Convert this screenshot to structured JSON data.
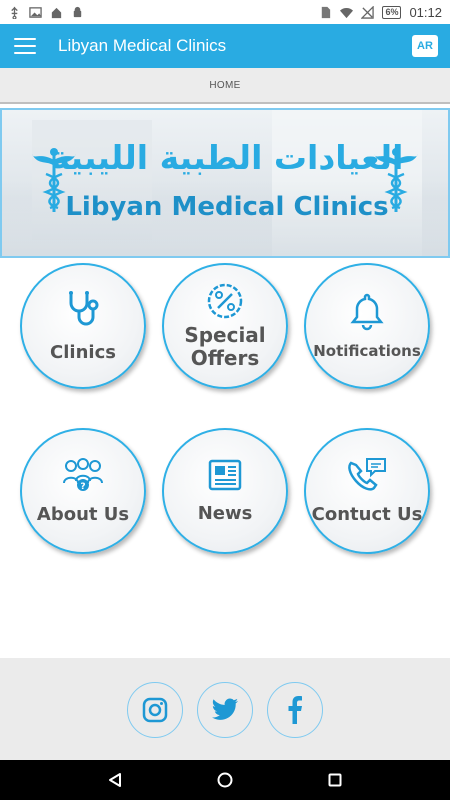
{
  "status_bar": {
    "battery": "6%",
    "time": "01:12",
    "left_icons": [
      "usb-icon",
      "image-icon",
      "home-icon",
      "android-icon"
    ],
    "right_icons": [
      "sim-icon",
      "wifi-icon",
      "no-signal-icon",
      "battery-charging-icon"
    ]
  },
  "app_bar": {
    "title": "Libyan Medical Clinics",
    "lang_button": "AR",
    "menu_icon": "hamburger-menu-icon"
  },
  "breadcrumb": {
    "label": "HOME"
  },
  "banner": {
    "arabic_title": "العيادات الطبية الليبية",
    "english_title": "Libyan Medical Clinics",
    "left_icon": "caduceus-icon",
    "right_icon": "caduceus-icon"
  },
  "tiles": [
    {
      "label_line1": "Clinics",
      "label_line2": "",
      "icon": "stethoscope-icon"
    },
    {
      "label_line1": "Special",
      "label_line2": "Offers",
      "icon": "percent-badge-icon"
    },
    {
      "label_line1": "Notifications",
      "label_line2": "",
      "icon": "bell-icon"
    },
    {
      "label_line1": "About Us",
      "label_line2": "",
      "icon": "group-question-icon"
    },
    {
      "label_line1": "News",
      "label_line2": "",
      "icon": "newspaper-icon"
    },
    {
      "label_line1": "Contuct Us",
      "label_line2": "",
      "icon": "phone-chat-icon"
    }
  ],
  "social": [
    {
      "name": "instagram",
      "icon": "instagram-icon"
    },
    {
      "name": "twitter",
      "icon": "twitter-icon"
    },
    {
      "name": "facebook",
      "icon": "facebook-icon"
    }
  ],
  "nav_bar": {
    "icons": [
      "back-triangle-icon",
      "home-circle-icon",
      "recents-square-icon"
    ]
  },
  "colors": {
    "primary": "#29abe2",
    "tile_border": "#2fb0e6",
    "icon_blue": "#1e98d4",
    "label_gray": "#555555",
    "footer_bg": "#ebebeb"
  }
}
